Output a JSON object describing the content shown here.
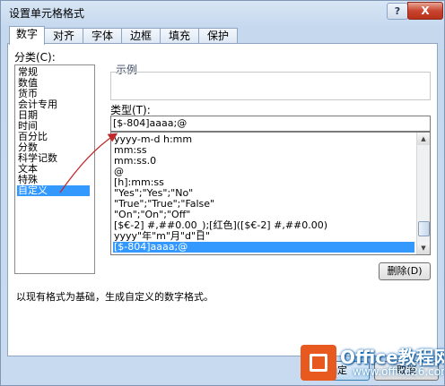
{
  "window": {
    "title": "设置单元格格式",
    "help_label": "?",
    "close_label": "X"
  },
  "tabs": [
    {
      "label": "数字",
      "active": true
    },
    {
      "label": "对齐",
      "active": false
    },
    {
      "label": "字体",
      "active": false
    },
    {
      "label": "边框",
      "active": false
    },
    {
      "label": "填充",
      "active": false
    },
    {
      "label": "保护",
      "active": false
    }
  ],
  "category": {
    "label": "分类(C):",
    "items": [
      "常规",
      "数值",
      "货币",
      "会计专用",
      "日期",
      "时间",
      "百分比",
      "分数",
      "科学记数",
      "文本",
      "特殊",
      "自定义"
    ],
    "selected": "自定义"
  },
  "sample": {
    "label": "示例"
  },
  "type": {
    "label": "类型(T):",
    "value": "[$-804]aaaa;@"
  },
  "formats": {
    "items": [
      "yyyy-m-d h:mm",
      "mm:ss",
      "mm:ss.0",
      "@",
      "[h]:mm:ss",
      "\"Yes\";\"Yes\";\"No\"",
      "\"True\";\"True\";\"False\"",
      "\"On\";\"On\";\"Off\"",
      "[$€-2] #,##0.00_);[红色]([$€-2] #,##0.00)",
      "yyyy\"年\"m\"月\"d\"日\"",
      "[$-804]aaaa;@"
    ],
    "selected": "[$-804]aaaa;@"
  },
  "buttons": {
    "delete": "删除(D)",
    "ok": "确定",
    "cancel": "取消"
  },
  "description": "以现有格式为基础，生成自定义的数字格式。",
  "watermark": {
    "line1": "Office教程网",
    "line2": "www.office26.com"
  }
}
